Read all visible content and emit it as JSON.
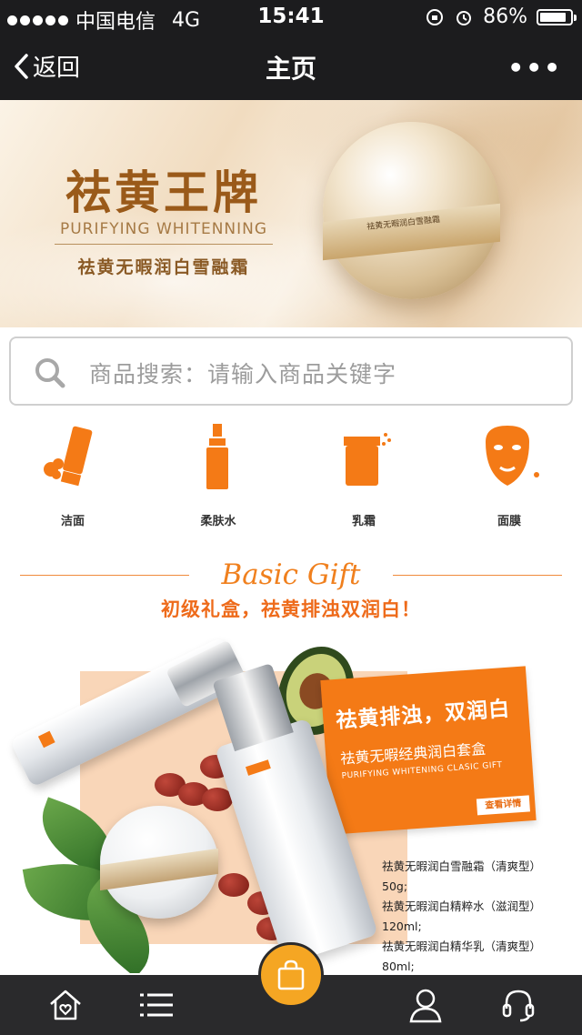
{
  "status_bar": {
    "carrier": "中国电信",
    "network": "4G",
    "time": "15:41",
    "battery": "86%",
    "battery_level": 0.86
  },
  "nav": {
    "back_label": "返回",
    "title": "主页",
    "more_label": "•••"
  },
  "banner": {
    "brand": "祛黄王牌",
    "brand_en": "PURIFYING WHITENNING",
    "product": "祛黄无暇润白雪融霜",
    "jar_label": "祛黄无暇润白雪融霜"
  },
  "search": {
    "placeholder": "商品搜索：请输入商品关键字"
  },
  "categories": [
    {
      "label": "洁面",
      "icon": "tube-icon"
    },
    {
      "label": "柔肤水",
      "icon": "bottle-icon"
    },
    {
      "label": "乳霜",
      "icon": "cream-jar-icon"
    },
    {
      "label": "面膜",
      "icon": "face-mask-icon"
    }
  ],
  "gift": {
    "title": "Basic Gift",
    "subtitle": "初级礼盒，祛黄排浊双润白！"
  },
  "promo_card": {
    "headline": "祛黄排浊，双润白",
    "name": "祛黄无暇经典润白套盒",
    "name_en": "PURIFYING WHITENING CLASIC GIFT",
    "button": "查看详情"
  },
  "product_list": [
    "祛黄无暇润白雪融霜（清爽型）",
    "50g;",
    "祛黄无暇润白精粹水（滋润型）",
    "120ml;",
    "祛黄无暇润白精华乳（清爽型）",
    "80ml;"
  ],
  "colors": {
    "accent": "#f47a16",
    "bar": "#1c1c1e",
    "tabbar": "#2a2a2c",
    "cart": "#f5a623"
  },
  "tabbar": {
    "items": [
      "home-icon",
      "list-icon",
      "shopping-bag-icon",
      "user-icon",
      "headset-icon"
    ]
  }
}
